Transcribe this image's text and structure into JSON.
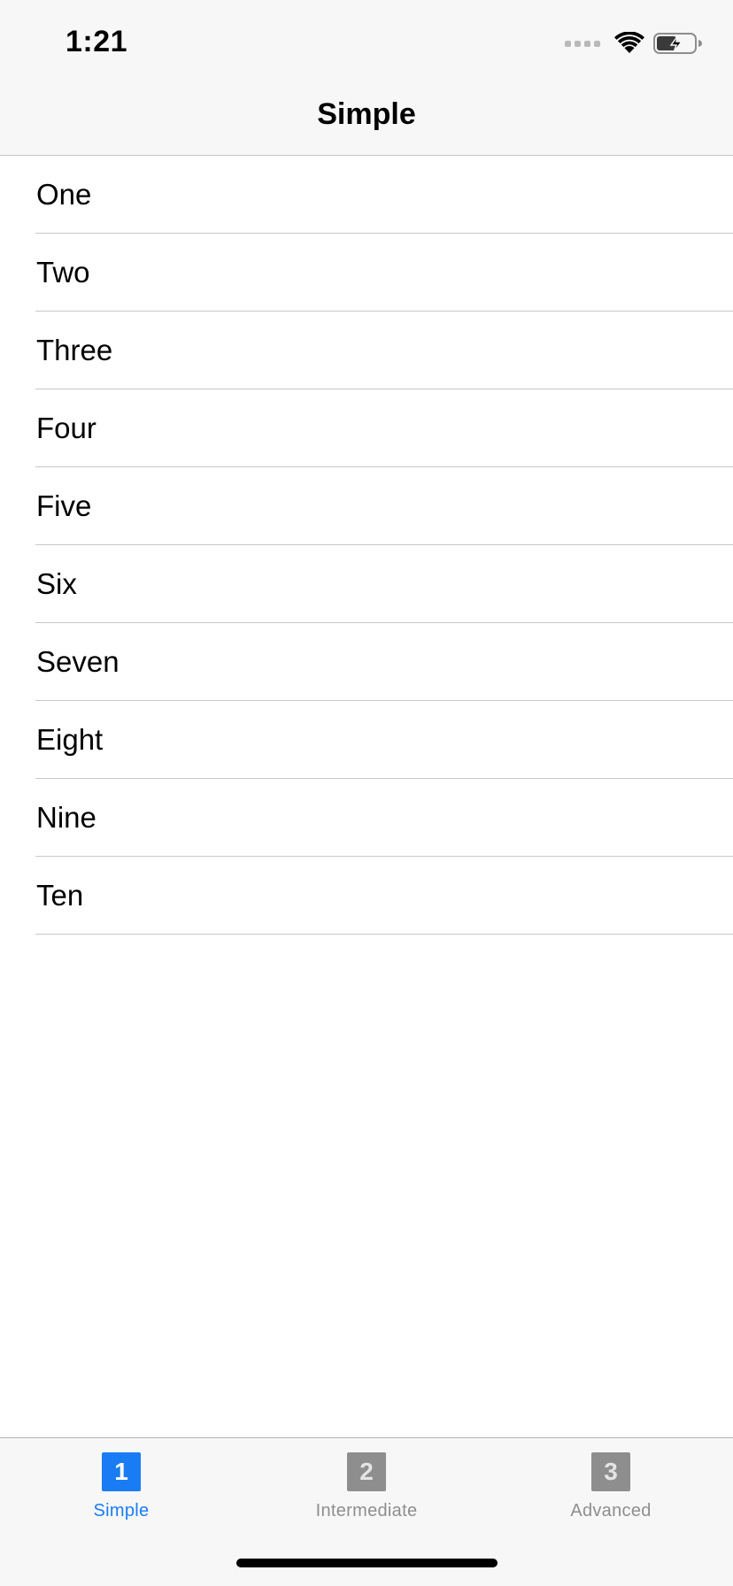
{
  "status_bar": {
    "time": "1:21",
    "icons": [
      "signal-icon",
      "wifi-icon",
      "battery-charging-icon"
    ]
  },
  "nav": {
    "title": "Simple"
  },
  "list": {
    "items": [
      {
        "label": "One"
      },
      {
        "label": "Two"
      },
      {
        "label": "Three"
      },
      {
        "label": "Four"
      },
      {
        "label": "Five"
      },
      {
        "label": "Six"
      },
      {
        "label": "Seven"
      },
      {
        "label": "Eight"
      },
      {
        "label": "Nine"
      },
      {
        "label": "Ten"
      }
    ]
  },
  "tabbar": {
    "tabs": [
      {
        "number": "1",
        "label": "Simple",
        "selected": true
      },
      {
        "number": "2",
        "label": "Intermediate",
        "selected": false
      },
      {
        "number": "3",
        "label": "Advanced",
        "selected": false
      }
    ]
  },
  "colors": {
    "accent": "#1a7cf5",
    "inactive": "#8e8e8e",
    "bar_background": "#f7f7f7",
    "separator": "#c8c8cc"
  }
}
